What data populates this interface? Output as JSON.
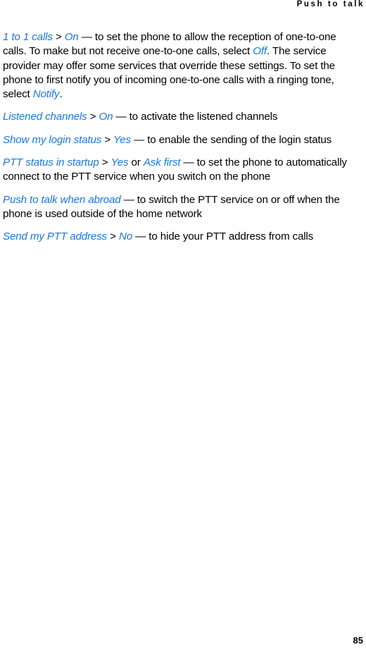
{
  "page": {
    "running_header": "Push to talk",
    "page_number": "85",
    "accent_color": "#1878e0",
    "text_color": "#000000",
    "background_color": "#ffffff"
  },
  "paragraphs": [
    {
      "id": "one-to-one-calls",
      "runs": [
        {
          "style": "ui",
          "text": "1 to 1 calls"
        },
        {
          "style": "plain",
          "text": " > "
        },
        {
          "style": "ui",
          "text": "On"
        },
        {
          "style": "plain",
          "text": " — to set the phone to allow the reception of one-to-one calls. To make but not receive one-to-one calls, select "
        },
        {
          "style": "ui",
          "text": "Off"
        },
        {
          "style": "plain",
          "text": ". The service provider may offer some services that override these settings. To set the phone to first notify you of incoming one-to-one calls with a ringing tone, select "
        },
        {
          "style": "ui",
          "text": "Notify"
        },
        {
          "style": "plain",
          "text": "."
        }
      ]
    },
    {
      "id": "listened-channels",
      "runs": [
        {
          "style": "ui",
          "text": "Listened channels"
        },
        {
          "style": "plain",
          "text": " > "
        },
        {
          "style": "ui",
          "text": "On"
        },
        {
          "style": "plain",
          "text": " — to activate the listened channels"
        }
      ]
    },
    {
      "id": "show-my-login-status",
      "runs": [
        {
          "style": "ui",
          "text": "Show my login status"
        },
        {
          "style": "plain",
          "text": " > "
        },
        {
          "style": "ui",
          "text": "Yes"
        },
        {
          "style": "plain",
          "text": " — to enable the sending of the login status"
        }
      ]
    },
    {
      "id": "ptt-status-in-startup",
      "runs": [
        {
          "style": "ui",
          "text": "PTT status in startup"
        },
        {
          "style": "plain",
          "text": " > "
        },
        {
          "style": "ui",
          "text": "Yes"
        },
        {
          "style": "plain",
          "text": " or "
        },
        {
          "style": "ui",
          "text": "Ask first"
        },
        {
          "style": "plain",
          "text": " — to set the phone to automatically connect to the PTT service when you switch on the phone"
        }
      ]
    },
    {
      "id": "push-to-talk-when-abroad",
      "runs": [
        {
          "style": "ui",
          "text": "Push to talk when abroad"
        },
        {
          "style": "plain",
          "text": " — to switch the PTT service on or off when the phone is used outside of the home network"
        }
      ]
    },
    {
      "id": "send-my-ptt-address",
      "runs": [
        {
          "style": "ui",
          "text": "Send my PTT address"
        },
        {
          "style": "plain",
          "text": " > "
        },
        {
          "style": "ui",
          "text": "No"
        },
        {
          "style": "plain",
          "text": " — to hide your PTT address from calls"
        }
      ]
    }
  ]
}
